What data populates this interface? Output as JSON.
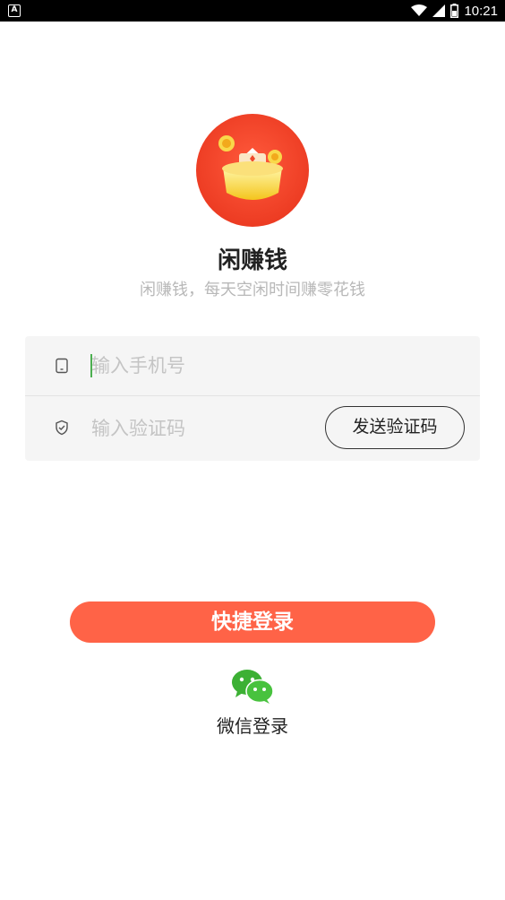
{
  "status_bar": {
    "left_icon": "A",
    "icons": [
      "wifi-icon",
      "signal-icon",
      "battery-icon"
    ],
    "time": "10:21"
  },
  "app": {
    "name": "闲赚钱",
    "slogan": "闲赚钱，每天空闲时间赚零花钱",
    "logo_icon": "gold-ingot-logo"
  },
  "form": {
    "phone_placeholder": "输入手机号",
    "phone_value": "",
    "code_placeholder": "输入验证码",
    "code_value": "",
    "send_code_label": "发送验证码",
    "phone_icon": "phone-icon",
    "code_icon": "shield-icon"
  },
  "login": {
    "quick_login_label": "快捷登录",
    "wechat_login_label": "微信登录",
    "wechat_icon": "wechat-icon"
  },
  "colors": {
    "accent": "#ff6347",
    "logo_red": "#f04a2f",
    "logo_gold": "#f7d23a",
    "wechat_green": "#39b52f",
    "placeholder": "#c4c4c4"
  }
}
